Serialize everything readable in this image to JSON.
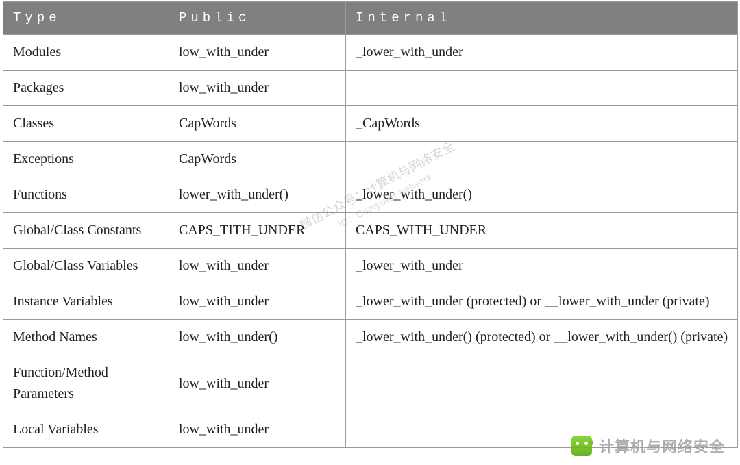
{
  "chart_data": {
    "type": "table",
    "headers": [
      "Type",
      "Public",
      "Internal"
    ],
    "rows": [
      [
        "Modules",
        "low_with_under",
        "_lower_with_under"
      ],
      [
        "Packages",
        "low_with_under",
        ""
      ],
      [
        "Classes",
        "CapWords",
        "_CapWords"
      ],
      [
        "Exceptions",
        "CapWords",
        ""
      ],
      [
        "Functions",
        "lower_with_under()",
        "_lower_with_under()"
      ],
      [
        "Global/Class Constants",
        "CAPS_TITH_UNDER",
        "CAPS_WITH_UNDER"
      ],
      [
        "Global/Class Variables",
        "low_with_under",
        "_lower_with_under"
      ],
      [
        "Instance Variables",
        "low_with_under",
        "_lower_with_under (protected) or __lower_with_under (private)"
      ],
      [
        "Method Names",
        "low_with_under()",
        "_lower_with_under() (protected) or __lower_with_under() (private)"
      ],
      [
        "Function/Method Parameters",
        "low_with_under",
        ""
      ],
      [
        "Local Variables",
        "low_with_under",
        ""
      ]
    ]
  },
  "watermark": {
    "line1": "微信公众号：计算机与网络安全",
    "line2": "ID：Computer-network"
  },
  "brand": {
    "text": "计算机与网络安全"
  }
}
